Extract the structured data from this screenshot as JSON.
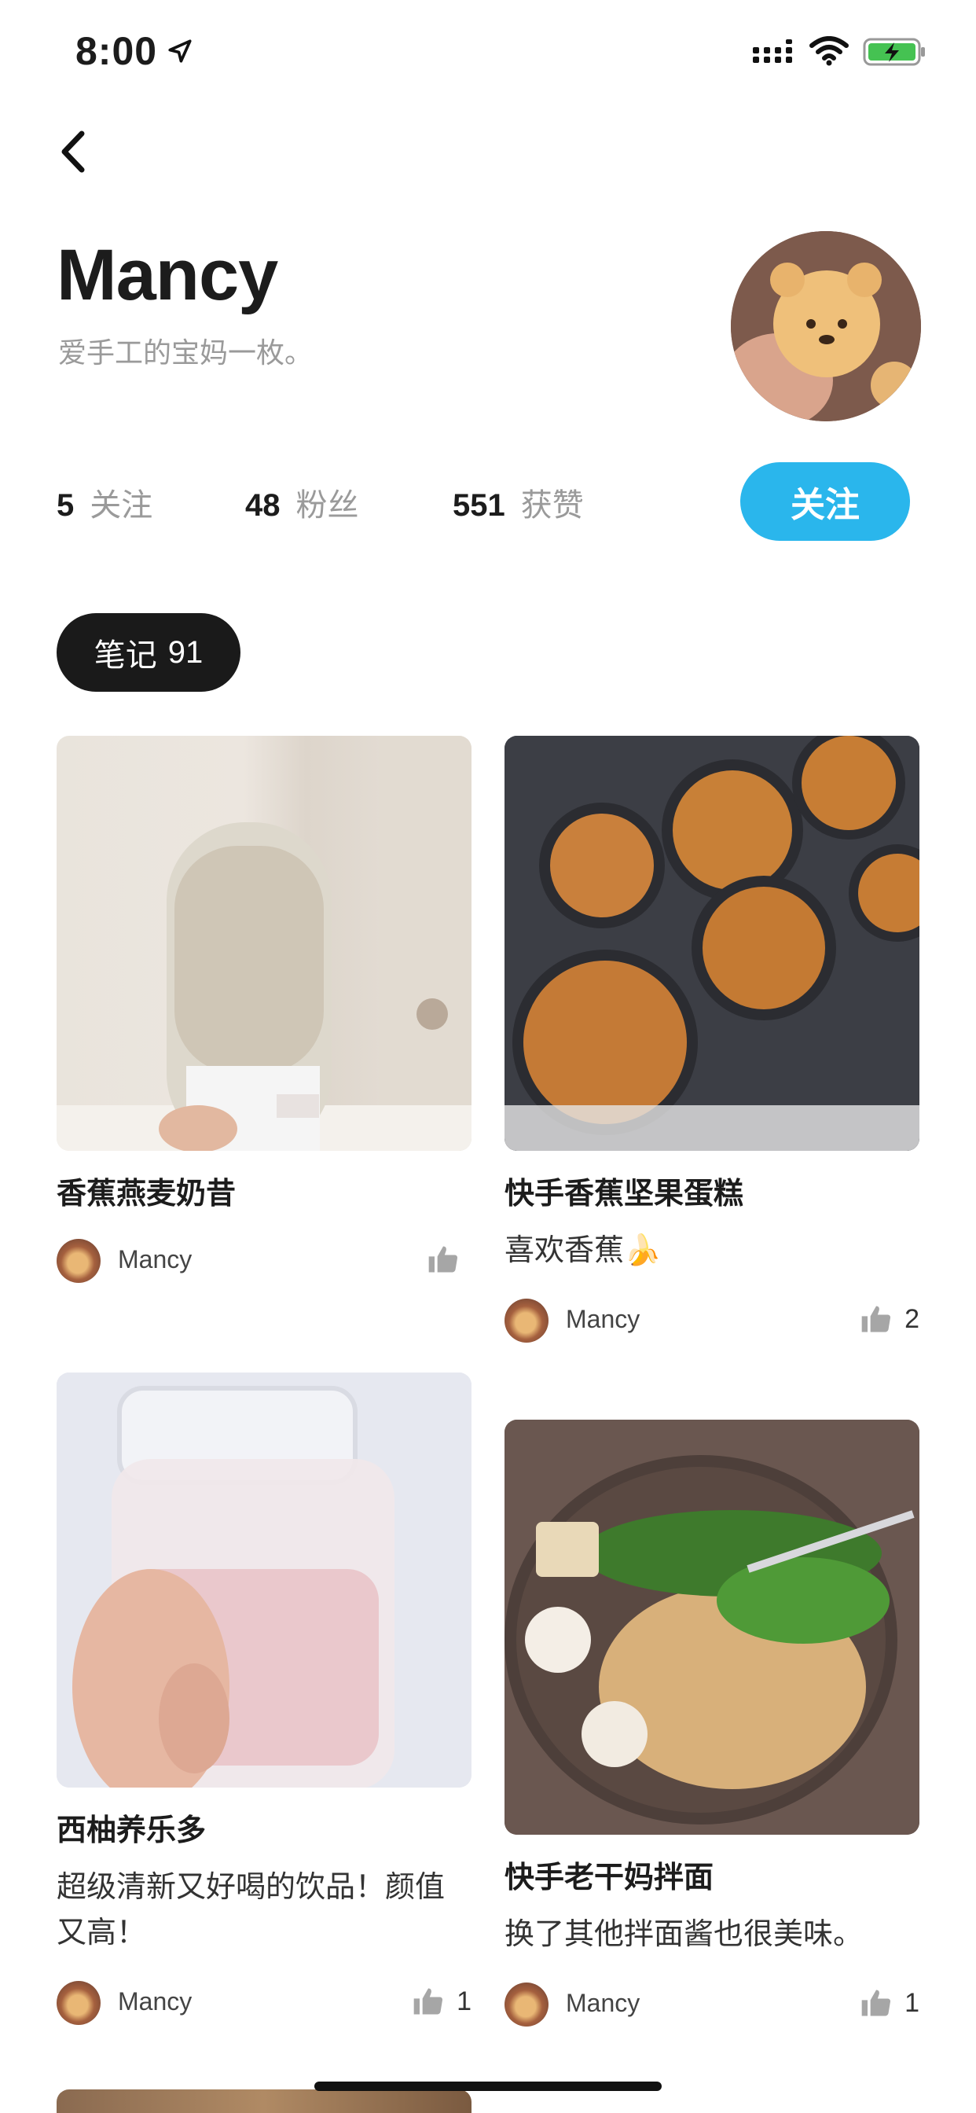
{
  "status_bar": {
    "time": "8:00"
  },
  "profile": {
    "name": "Mancy",
    "bio": "爱手工的宝妈一枚。",
    "stats": [
      {
        "value": "5",
        "label": "关注"
      },
      {
        "value": "48",
        "label": "粉丝"
      },
      {
        "value": "551",
        "label": "获赞"
      }
    ],
    "follow_label": "关注"
  },
  "tabs": {
    "notes_label": "笔记",
    "notes_count": "91"
  },
  "notes": [
    {
      "title": "香蕉燕麦奶昔",
      "desc": "",
      "author": "Mancy",
      "likes": ""
    },
    {
      "title": "快手香蕉坚果蛋糕",
      "desc": "喜欢香蕉🍌",
      "author": "Mancy",
      "likes": "2"
    },
    {
      "title": "西柚养乐多",
      "desc": "超级清新又好喝的饮品！颜值又高！",
      "author": "Mancy",
      "likes": "1"
    },
    {
      "title": "快手老干妈拌面",
      "desc": "换了其他拌面酱也很美味。",
      "author": "Mancy",
      "likes": "1"
    }
  ],
  "colors": {
    "accent": "#2ab6ec",
    "tab_bg": "#1a1a1a",
    "muted_text": "#9a9a9a"
  },
  "icons": [
    "location-arrow-icon",
    "cellular-signal-icon",
    "wifi-icon",
    "battery-charging-icon",
    "back-chevron-icon",
    "thumbs-up-icon"
  ]
}
